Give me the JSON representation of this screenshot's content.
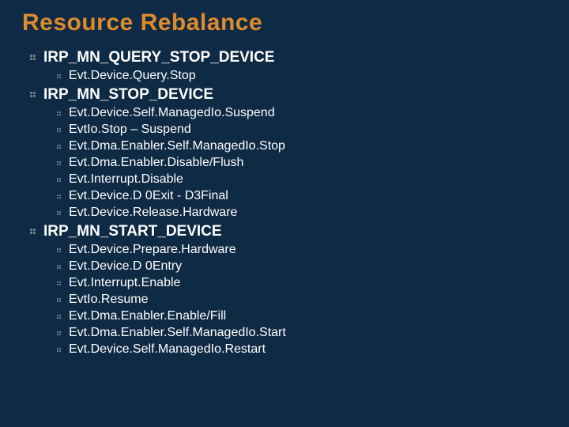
{
  "title": "Resource Rebalance",
  "sections": [
    {
      "heading": "IRP_MN_QUERY_STOP_DEVICE",
      "items": [
        "Evt.Device.Query.Stop"
      ]
    },
    {
      "heading": "IRP_MN_STOP_DEVICE",
      "items": [
        "Evt.Device.Self.ManagedIo.Suspend",
        "EvtIo.Stop – Suspend",
        "Evt.Dma.Enabler.Self.ManagedIo.Stop",
        "Evt.Dma.Enabler.Disable/Flush",
        "Evt.Interrupt.Disable",
        "Evt.Device.D 0Exit - D3Final",
        "Evt.Device.Release.Hardware"
      ]
    },
    {
      "heading": "IRP_MN_START_DEVICE",
      "items": [
        "Evt.Device.Prepare.Hardware",
        "Evt.Device.D 0Entry",
        "Evt.Interrupt.Enable",
        "EvtIo.Resume",
        "Evt.Dma.Enabler.Enable/Fill",
        "Evt.Dma.Enabler.Self.ManagedIo.Start",
        "Evt.Device.Self.ManagedIo.Restart"
      ]
    }
  ]
}
